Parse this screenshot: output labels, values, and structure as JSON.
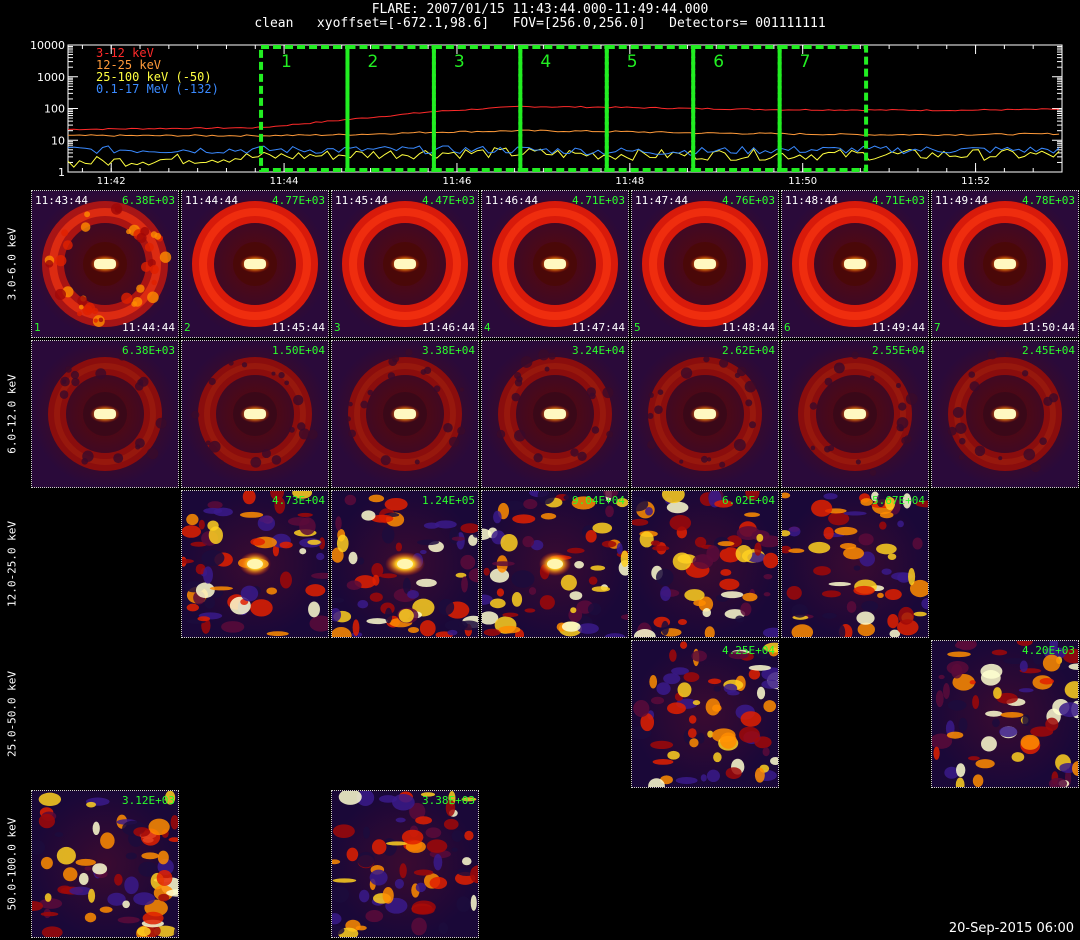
{
  "header": {
    "line1": "FLARE: 2007/01/15 11:43:44.000-11:49:44.000",
    "line2": "clean   xyoffset=[-672.1,98.6]   FOV=[256.0,256.0]   Detectors= 001111111"
  },
  "chart_data": {
    "type": "line",
    "x_label_unit": "UT",
    "xticks": [
      "11:42",
      "11:44",
      "11:46",
      "11:48",
      "11:50",
      "11:52"
    ],
    "xlim": [
      "11:41:30",
      "11:53:00"
    ],
    "yscale": "log",
    "ylim": [
      1,
      10000
    ],
    "yticks": [
      "1",
      "10",
      "100",
      "1000",
      "10000"
    ],
    "series": [
      {
        "name": "3-12 keV",
        "color": "#ff2a2a",
        "x": [
          "11:41:30",
          "11:43:44",
          "11:44:44",
          "11:45:44",
          "11:46:44",
          "11:47:44",
          "11:48:44",
          "11:49:44",
          "11:50:44",
          "11:51:44",
          "11:53:00"
        ],
        "y": [
          22,
          25,
          45,
          80,
          115,
          110,
          100,
          92,
          90,
          88,
          95
        ]
      },
      {
        "name": "12-25 keV",
        "color": "#ff9a3a",
        "x": [
          "11:41:30",
          "11:43:44",
          "11:44:44",
          "11:45:44",
          "11:46:44",
          "11:47:44",
          "11:48:44",
          "11:49:44",
          "11:50:44",
          "11:51:44",
          "11:53:00"
        ],
        "y": [
          14,
          14,
          15,
          18,
          20,
          19,
          17,
          16,
          15,
          15,
          16
        ]
      },
      {
        "name": "25-100 keV (-50)",
        "color": "#ffff40",
        "x": [
          "11:41:30",
          "11:43:44",
          "11:44:44",
          "11:45:44",
          "11:46:44",
          "11:47:44",
          "11:48:44",
          "11:49:44",
          "11:50:44",
          "11:51:44",
          "11:53:00"
        ],
        "y": [
          2,
          3,
          3.5,
          4,
          4,
          3.5,
          3.5,
          3.5,
          3.5,
          3.5,
          3.5
        ]
      },
      {
        "name": "0.1-17 MeV (-132)",
        "color": "#3a8aff",
        "x": [
          "11:41:30",
          "11:43:44",
          "11:44:44",
          "11:45:44",
          "11:46:44",
          "11:47:44",
          "11:48:44",
          "11:49:44",
          "11:50:44",
          "11:51:44",
          "11:53:00"
        ],
        "y": [
          5,
          5,
          5,
          5,
          5,
          4.5,
          4.5,
          5,
          5,
          5,
          5
        ]
      }
    ],
    "intervals": [
      {
        "label": "1",
        "start": "11:43:44",
        "end": "11:44:44"
      },
      {
        "label": "2",
        "start": "11:44:44",
        "end": "11:45:44"
      },
      {
        "label": "3",
        "start": "11:45:44",
        "end": "11:46:44"
      },
      {
        "label": "4",
        "start": "11:46:44",
        "end": "11:47:44"
      },
      {
        "label": "5",
        "start": "11:47:44",
        "end": "11:48:44"
      },
      {
        "label": "6",
        "start": "11:48:44",
        "end": "11:49:44"
      },
      {
        "label": "7",
        "start": "11:49:44",
        "end": "11:50:44"
      }
    ],
    "interval_color": "#22ee22"
  },
  "energy_bands": [
    "3.0-6.0 keV",
    "6.0-12.0 keV",
    "12.0-25.0 keV",
    "25.0-50.0 keV",
    "50.0-100.0 keV"
  ],
  "images": [
    {
      "band": 0,
      "interval": 0,
      "start": "11:43:44",
      "end": "11:44:44",
      "index": "1",
      "max": "6.38E+03",
      "kind": "ring-noisy"
    },
    {
      "band": 0,
      "interval": 1,
      "start": "11:44:44",
      "end": "11:45:44",
      "index": "2",
      "max": "4.77E+03",
      "kind": "ring"
    },
    {
      "band": 0,
      "interval": 2,
      "start": "11:45:44",
      "end": "11:46:44",
      "index": "3",
      "max": "4.47E+03",
      "kind": "ring"
    },
    {
      "band": 0,
      "interval": 3,
      "start": "11:46:44",
      "end": "11:47:44",
      "index": "4",
      "max": "4.71E+03",
      "kind": "ring"
    },
    {
      "band": 0,
      "interval": 4,
      "start": "11:47:44",
      "end": "11:48:44",
      "index": "5",
      "max": "4.76E+03",
      "kind": "ring"
    },
    {
      "band": 0,
      "interval": 5,
      "start": "11:48:44",
      "end": "11:49:44",
      "index": "6",
      "max": "4.71E+03",
      "kind": "ring"
    },
    {
      "band": 0,
      "interval": 6,
      "start": "11:49:44",
      "end": "11:50:44",
      "index": "7",
      "max": "4.78E+03",
      "kind": "ring"
    },
    {
      "band": 1,
      "interval": 0,
      "max": "6.38E+03",
      "kind": "ring-dim"
    },
    {
      "band": 1,
      "interval": 1,
      "max": "1.50E+04",
      "kind": "ring-dim"
    },
    {
      "band": 1,
      "interval": 2,
      "max": "3.38E+04",
      "kind": "ring-dim"
    },
    {
      "band": 1,
      "interval": 3,
      "max": "3.24E+04",
      "kind": "ring-dim"
    },
    {
      "band": 1,
      "interval": 4,
      "max": "2.62E+04",
      "kind": "ring-dim"
    },
    {
      "band": 1,
      "interval": 5,
      "max": "2.55E+04",
      "kind": "ring-dim"
    },
    {
      "band": 1,
      "interval": 6,
      "max": "2.45E+04",
      "kind": "ring-dim"
    },
    {
      "band": 2,
      "interval": 1,
      "max": "4.73E+04",
      "kind": "noise-source"
    },
    {
      "band": 2,
      "interval": 2,
      "max": "1.24E+05",
      "kind": "noise-source-strong"
    },
    {
      "band": 2,
      "interval": 3,
      "max": "9.04E+04",
      "kind": "noise-source"
    },
    {
      "band": 2,
      "interval": 4,
      "max": "6.02E+04",
      "kind": "noise"
    },
    {
      "band": 2,
      "interval": 5,
      "max": "5.67E+04",
      "kind": "noise"
    },
    {
      "band": 3,
      "interval": 4,
      "max": "4.25E+04",
      "kind": "noise"
    },
    {
      "band": 3,
      "interval": 6,
      "max": "4.20E+03",
      "kind": "noise"
    },
    {
      "band": 4,
      "interval": 0,
      "max": "3.12E+03",
      "kind": "noise"
    },
    {
      "band": 4,
      "interval": 2,
      "max": "3.38E+03",
      "kind": "noise"
    }
  ],
  "footer": "20-Sep-2015 06:00"
}
